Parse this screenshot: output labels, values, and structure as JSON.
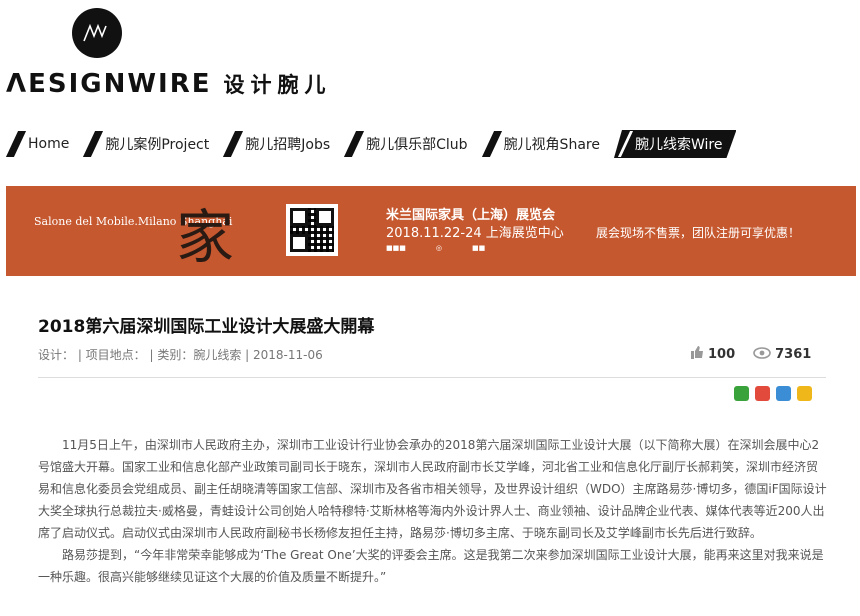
{
  "brand": {
    "logo_mark": "ΛW",
    "wordmark": "ΛESIGNWIRE",
    "cn_name": "设计腕儿"
  },
  "nav": {
    "items": [
      {
        "label": "Home"
      },
      {
        "label": "腕儿案例Project"
      },
      {
        "label": "腕儿招聘Jobs"
      },
      {
        "label": "腕儿俱乐部Club"
      },
      {
        "label": "腕儿视角Share"
      },
      {
        "label": "腕儿线索Wire",
        "active": true
      }
    ]
  },
  "banner": {
    "salone": "Salone del Mobile.Milano Shanghai",
    "jia": "家",
    "title": "米兰国际家具（上海）展览会",
    "date_venue": "2018.11.22-24 上海展览中心",
    "promo": "展会现场不售票，团队注册可享优惠！",
    "bg_color": "#c6582f"
  },
  "article": {
    "title": "2018第六届深圳国际工业设计大展盛大開幕",
    "meta": "设计：  | 项目地点：  | 类别：腕儿线索 | 2018-11-06",
    "likes": "100",
    "views": "7361",
    "paragraphs": [
      "11月5日上午，由深圳市人民政府主办，深圳市工业设计行业协会承办的2018第六届深圳国际工业设计大展（以下简称大展）在深圳会展中心2号馆盛大开幕。国家工业和信息化部产业政策司副司长于晓东，深圳市人民政府副市长艾学峰，河北省工业和信息化厅副厅长郝莉笑，深圳市经济贸易和信息化委员会党组成员、副主任胡晓清等国家工信部、深圳市及各省市相关领导，及世界设计组织（WDO）主席路易莎·博切多，德国iF国际设计大奖全球执行总裁拉夫·威格曼，青蛙设计公司创始人哈特穆特·艾斯林格等海内外设计界人士、商业领袖、设计品牌企业代表、媒体代表等近200人出席了启动仪式。启动仪式由深圳市人民政府副秘书长杨修友担任主持，路易莎·博切多主席、于晓东副司长及艾学峰副市长先后进行致辞。",
      "路易莎提到，“今年非常荣幸能够成为‘The Great One’大奖的评委会主席。这是我第二次来参加深圳国际工业设计大展，能再来这里对我来说是一种乐趣。很高兴能够继续见证这个大展的价值及质量不断提升。”"
    ]
  },
  "share_icons": [
    "wechat-icon",
    "weibo-icon",
    "pinterest-icon",
    "qzone-icon"
  ]
}
